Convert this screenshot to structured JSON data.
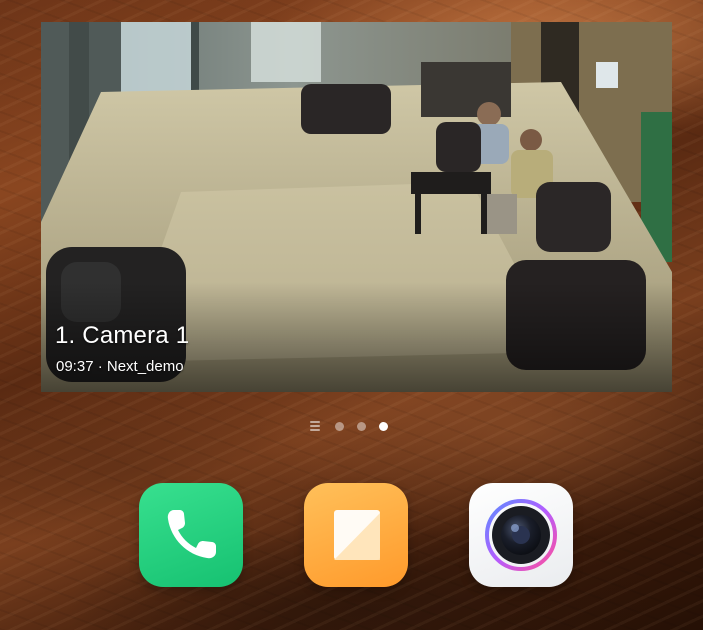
{
  "camera_widget": {
    "title": "1. Camera 1",
    "meta": "09:37 · Next_demo"
  },
  "page_indicator": {
    "pages": 3,
    "active_page": 3
  },
  "dock": {
    "apps": [
      {
        "icon": "phone-icon",
        "color": "#1fcf7c"
      },
      {
        "icon": "notes-icon",
        "color": "#ffab3d"
      },
      {
        "icon": "camera-app-icon",
        "color": "#f2f3f5"
      }
    ]
  }
}
